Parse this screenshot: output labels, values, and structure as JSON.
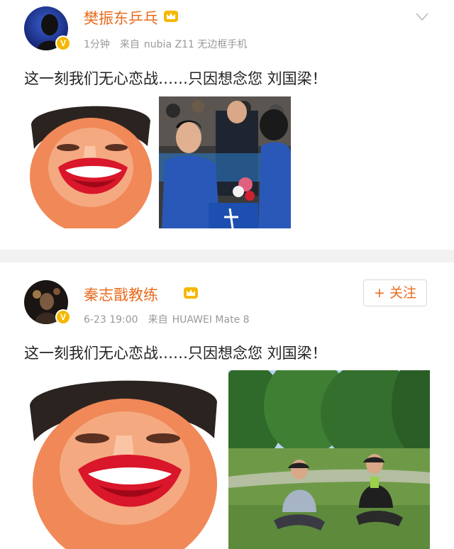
{
  "posts": [
    {
      "username": "樊振东乒乓",
      "verified_badge": "V",
      "badge_icon": "crown-badge-icon",
      "time": "1分钟",
      "source_label": "来自",
      "device": "nubia Z11 无边框手机",
      "menu_icon": "chevron-down-icon",
      "text": "这一刻我们无心恋战……只因想念您 刘国梁！",
      "images": [
        "caricature-photo",
        "ceremony-photo"
      ]
    },
    {
      "username": "秦志戬教练",
      "verified_badge": "V",
      "badge_icon": "crown-badge-icon",
      "time": "6-23 19:00",
      "source_label": "来自",
      "device": "HUAWEI Mate 8",
      "follow_label": "+ 关注",
      "text": "这一刻我们无心恋战……只因想念您 刘国梁！",
      "images": [
        "caricature-photo",
        "park-photo"
      ]
    }
  ],
  "colors": {
    "username": "#e86b1e",
    "meta": "#999999",
    "verified": "#f5b800",
    "divider": "#f2f2f2"
  }
}
